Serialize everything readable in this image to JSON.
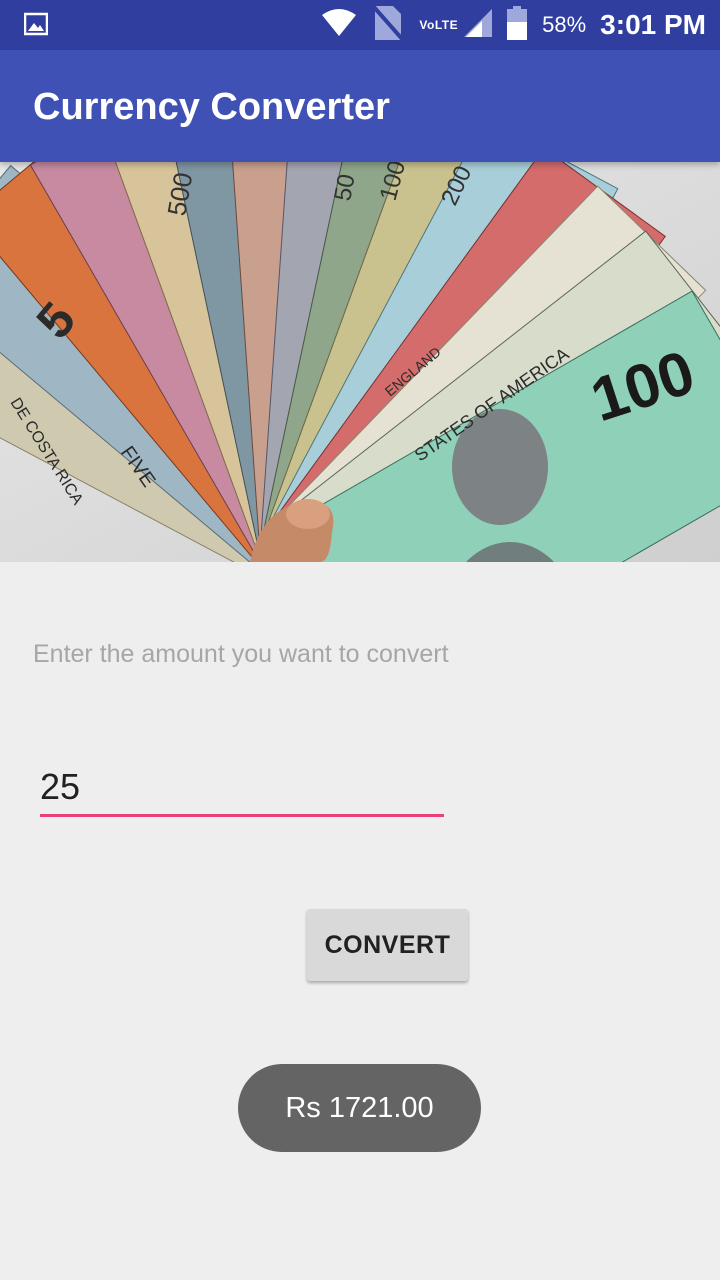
{
  "status_bar": {
    "network_label": "VoLTE",
    "battery": "58%",
    "time": "3:01 PM",
    "icons": [
      "image-icon",
      "wifi-icon",
      "no-sim-icon",
      "signal-icon",
      "battery-icon"
    ]
  },
  "app_bar": {
    "title": "Currency Converter",
    "color": "#3f51b5"
  },
  "hero": {
    "note_labels": [
      "500",
      "50",
      "100",
      "200",
      "5",
      "100",
      "FIVE",
      "STATES OF AMERICA",
      "DE COSTA RICA",
      "ENGLAND"
    ]
  },
  "form": {
    "prompt": "Enter the amount you want to convert",
    "amount_value": "25",
    "accent_color": "#ec407a"
  },
  "button": {
    "label": "CONVERT"
  },
  "toast": {
    "message": "Rs 1721.00"
  }
}
